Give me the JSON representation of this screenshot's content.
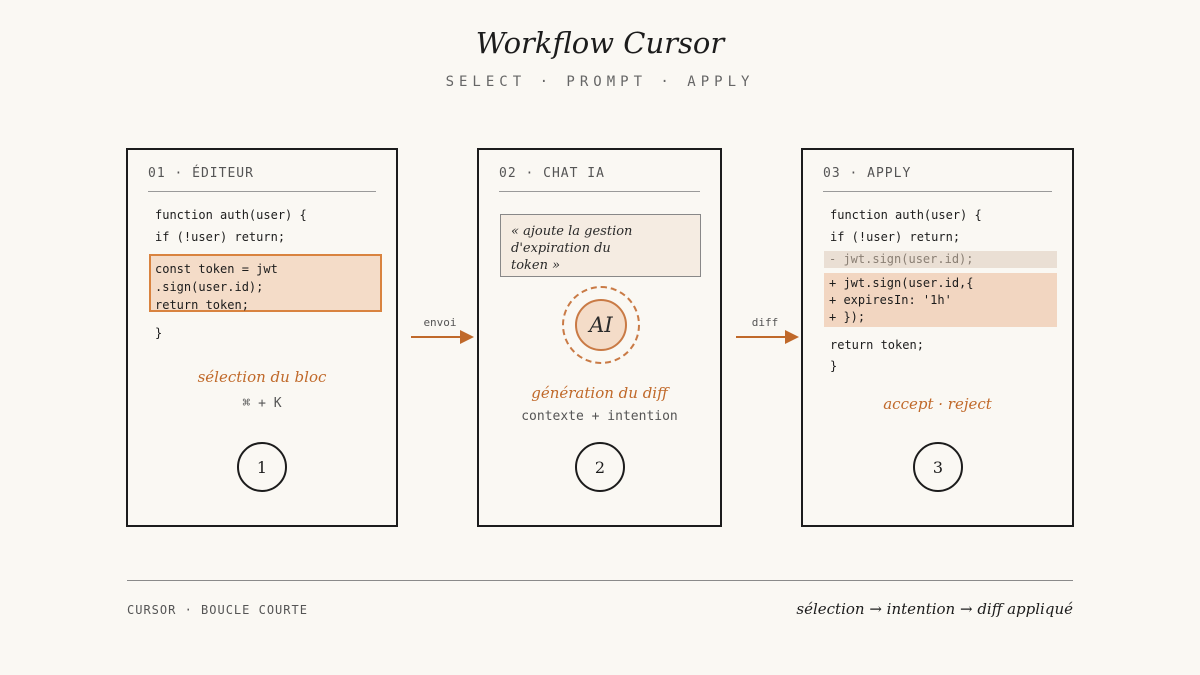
{
  "title": "Workflow Cursor",
  "subtitle": "SELECT · PROMPT · APPLY",
  "colors": {
    "accent": "#c0692a",
    "highlight": "#f4dcc8",
    "background": "#faf8f3",
    "ink": "#1c1c1c"
  },
  "step1": {
    "header": "01 · ÉDITEUR",
    "code_before": [
      "function auth(user) {",
      "if (!user) return;"
    ],
    "code_selected": [
      "const token = jwt",
      ".sign(user.id);",
      "return token;"
    ],
    "code_after": [
      "}"
    ],
    "caption": "sélection du bloc",
    "shortcut": "⌘ + K",
    "number": "1"
  },
  "arrow1": {
    "label": "envoi"
  },
  "step2": {
    "header": "02 · CHAT IA",
    "prompt_lines": [
      "« ajoute la gestion",
      "d'expiration du",
      "token »"
    ],
    "ai_label": "AI",
    "caption": "génération du diff",
    "sub_caption": "contexte + intention",
    "number": "2"
  },
  "arrow2": {
    "label": "diff"
  },
  "step3": {
    "header": "03 · APPLY",
    "code_before": [
      "function auth(user) {",
      "if (!user) return;"
    ],
    "removed_line": "- jwt.sign(user.id);",
    "added_lines": [
      "+ jwt.sign(user.id,{",
      "+ expiresIn: '1h'",
      "+ });"
    ],
    "code_after": [
      "return token;",
      "}"
    ],
    "caption": "accept · reject",
    "number": "3"
  },
  "footer": {
    "left": "CURSOR · BOUCLE COURTE",
    "right": "sélection → intention → diff appliqué"
  }
}
